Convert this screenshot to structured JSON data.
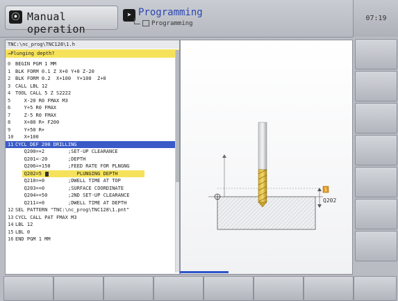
{
  "header": {
    "mode_label": "Manual operation",
    "program_title": "Programming",
    "program_subtitle": "Programming",
    "clock": "07:19"
  },
  "editor": {
    "path": "TNC:\\nc_prog\\TNC128\\1.h",
    "dialog_prompt": "→Plunging depth?",
    "lines": [
      {
        "n": "0",
        "text": "BEGIN PGM 1 MM",
        "comment": ""
      },
      {
        "n": "1",
        "text": "BLK FORM 0.1 Z X+0 Y+0 Z-20",
        "comment": ""
      },
      {
        "n": "2",
        "text": "BLK FORM 0.2  X+100  Y+100  Z+0",
        "comment": ""
      },
      {
        "n": "3",
        "text": "CALL LBL 12",
        "comment": ""
      },
      {
        "n": "4",
        "text": "TOOL CALL 5 Z S2222",
        "comment": ""
      },
      {
        "n": "5",
        "text": "   X-20 R0 FMAX M3",
        "comment": ""
      },
      {
        "n": "6",
        "text": "   Y+5 R0 FMAX",
        "comment": ""
      },
      {
        "n": "7",
        "text": "   Z-5 R0 FMAX",
        "comment": ""
      },
      {
        "n": "8",
        "text": "   X+80 R+ F200",
        "comment": ""
      },
      {
        "n": "9",
        "text": "   Y+50 R+",
        "comment": ""
      },
      {
        "n": "10",
        "text": "   X+100",
        "comment": ""
      },
      {
        "n": "11",
        "text": "CYCL DEF 200 DRILLING",
        "comment": ""
      },
      {
        "n": "",
        "text": "   Q200=+2",
        "comment": ";SET-UP CLEARANCE"
      },
      {
        "n": "",
        "text": "   Q201=-20",
        "comment": ";DEPTH"
      },
      {
        "n": "",
        "text": "   Q206=+150",
        "comment": ";FEED RATE FOR PLNGNG"
      },
      {
        "n": "",
        "text": "   Q202=5",
        "comment": "   PLUNGING DEPTH"
      },
      {
        "n": "",
        "text": "   Q210=+0",
        "comment": ";DWELL TIME AT TOP"
      },
      {
        "n": "",
        "text": "   Q203=+0",
        "comment": ";SURFACE COORDINATE"
      },
      {
        "n": "",
        "text": "   Q204=+50",
        "comment": ";2ND SET-UP CLEARANCE"
      },
      {
        "n": "",
        "text": "   Q211=+0",
        "comment": ";DWELL TIME AT DEPTH"
      },
      {
        "n": "12",
        "text": "SEL PATTERN \"TNC:\\nc_prog\\TNC128\\1.pnt\"",
        "comment": ""
      },
      {
        "n": "13",
        "text": "CYCL CALL PAT FMAX M3",
        "comment": ""
      },
      {
        "n": "14",
        "text": "LBL 12",
        "comment": ""
      },
      {
        "n": "15",
        "text": "LBL 0",
        "comment": ""
      },
      {
        "n": "16",
        "text": "END PGM 1 MM",
        "comment": ""
      }
    ]
  },
  "graphic": {
    "parameter_label": "Q202",
    "marker_label": "1"
  },
  "colors": {
    "selection": "#3a5bc7",
    "dialog": "#f5e25a",
    "accent": "#2a46b0"
  },
  "icons": {
    "mode": "manual-operation-icon",
    "program": "programming-icon"
  }
}
